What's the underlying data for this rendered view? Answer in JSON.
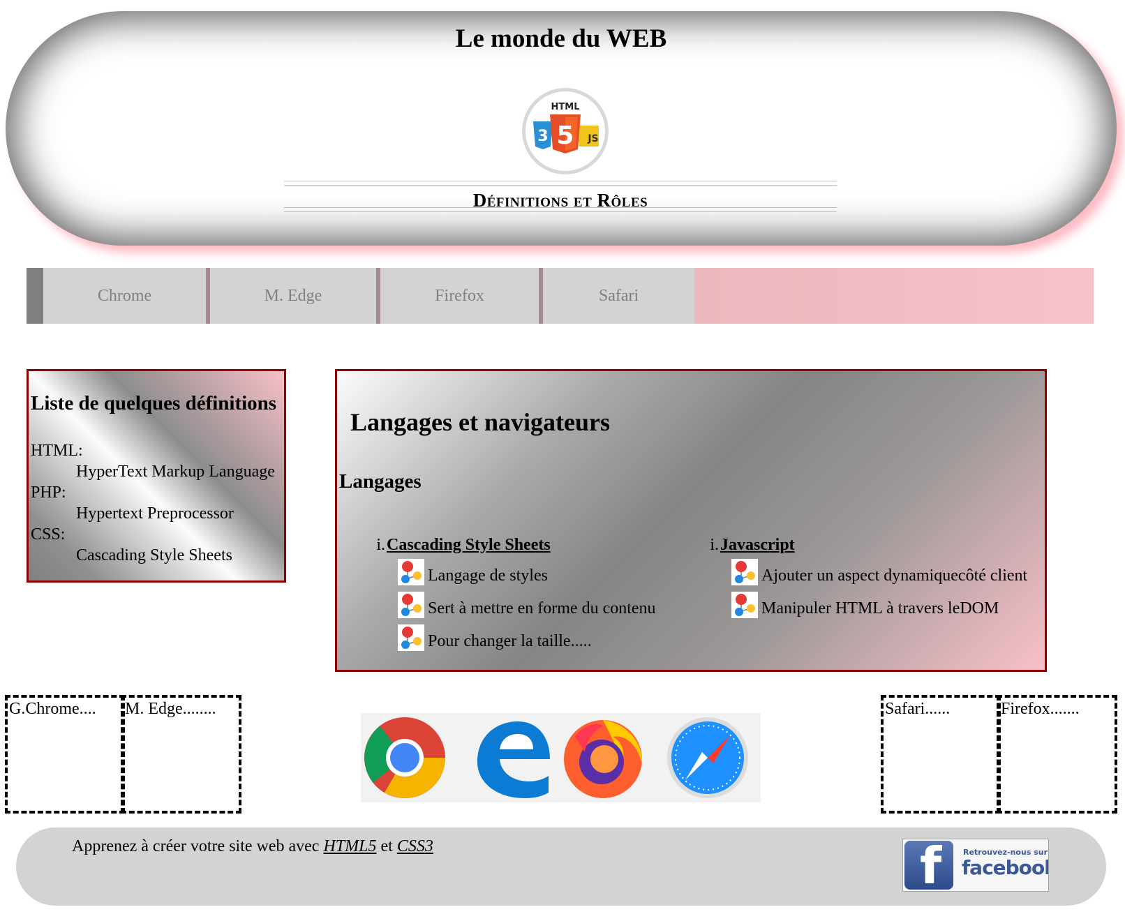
{
  "header": {
    "title": "Le monde du WEB",
    "logo_label": "HTML",
    "logo_js": "JS",
    "subtitle": "Définitions et Rôles"
  },
  "nav": {
    "items": [
      {
        "label": "Chrome"
      },
      {
        "label": "M. Edge"
      },
      {
        "label": "Firefox"
      },
      {
        "label": "Safari"
      }
    ]
  },
  "aside": {
    "title": "Liste de quelques définitions",
    "definitions": [
      {
        "term": "HTML:",
        "desc": "HyperText Markup Language"
      },
      {
        "term": "PHP:",
        "desc": "Hypertext Preprocessor"
      },
      {
        "term": "CSS:",
        "desc": "Cascading Style Sheets"
      }
    ]
  },
  "section": {
    "title": "Langages et navigateurs",
    "subtitle": "Langages",
    "columns": [
      {
        "number": "i.",
        "title": "Cascading Style Sheets",
        "bullets": [
          "Langage de styles",
          "Sert à mettre en forme du contenu",
          "Pour changer la taille....."
        ]
      },
      {
        "number": "i.",
        "title": "Javascript",
        "bullets": [
          "Ajouter un aspect dynamiquecôté client",
          "Manipuler HTML à travers leDOM"
        ]
      }
    ]
  },
  "footer_boxes": {
    "left": [
      "G.Chrome....",
      "M. Edge........"
    ],
    "right": [
      "Safari......",
      "Firefox......."
    ]
  },
  "browser_icons": [
    "chrome-icon",
    "edge-icon",
    "firefox-icon",
    "safari-icon"
  ],
  "footer": {
    "text_prefix": "Apprenez à créer votre site web avec ",
    "link1": "HTML5",
    "text_mid": " et ",
    "link2": "CSS3",
    "fb_small": "Retrouvez-nous sur",
    "fb_big": "facebook",
    "fb_letter": "f"
  },
  "colors": {
    "border": "#8b0000",
    "pink": "#f9c1c9",
    "nav_bg": "#d3d3d3",
    "footer_bg": "#d3d3d3"
  }
}
